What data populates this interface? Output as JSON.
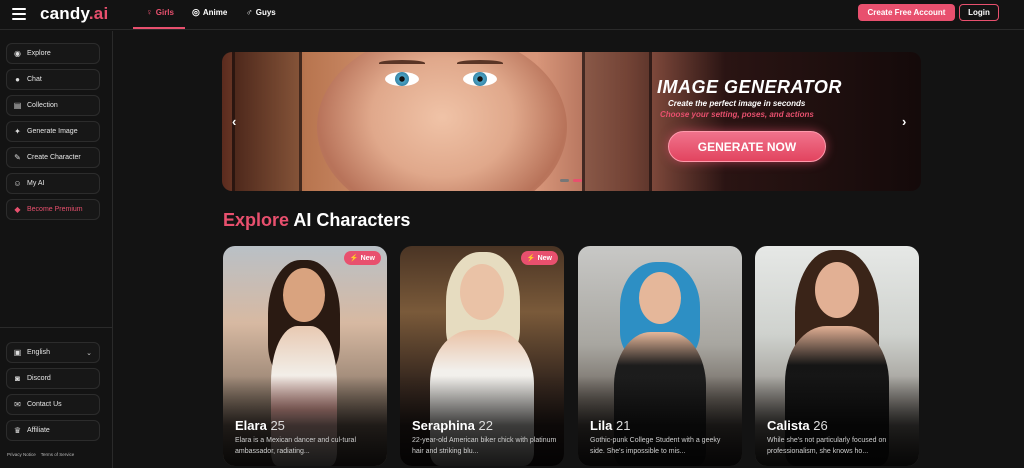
{
  "header": {
    "logo_text": "candy",
    "logo_dot": ".ai",
    "tabs": [
      {
        "label": "Girls",
        "icon": "female-icon",
        "glyph": "♀"
      },
      {
        "label": "Anime",
        "icon": "anime-icon",
        "glyph": "◎"
      },
      {
        "label": "Guys",
        "icon": "male-icon",
        "glyph": "♂"
      }
    ],
    "create_account": "Create Free Account",
    "login": "Login"
  },
  "sidebar": {
    "items": [
      {
        "label": "Explore",
        "icon": "compass-icon",
        "glyph": "◉"
      },
      {
        "label": "Chat",
        "icon": "chat-icon",
        "glyph": "●"
      },
      {
        "label": "Collection",
        "icon": "collection-icon",
        "glyph": "▤"
      },
      {
        "label": "Generate Image",
        "icon": "image-gen-icon",
        "glyph": "✦"
      },
      {
        "label": "Create Character",
        "icon": "wand-icon",
        "glyph": "✎"
      },
      {
        "label": "My AI",
        "icon": "mask-icon",
        "glyph": "☺"
      },
      {
        "label": "Become Premium",
        "icon": "diamond-icon",
        "glyph": "◆"
      }
    ],
    "bottom": [
      {
        "label": "English",
        "icon": "flag-icon",
        "glyph": "▣"
      },
      {
        "label": "Discord",
        "icon": "discord-icon",
        "glyph": "◙"
      },
      {
        "label": "Contact Us",
        "icon": "mail-icon",
        "glyph": "✉"
      },
      {
        "label": "Affiliate",
        "icon": "trophy-icon",
        "glyph": "♛"
      }
    ],
    "footer_links": [
      "Privacy Notice",
      "Terms of Service"
    ]
  },
  "banner": {
    "title": "IMAGE GENERATOR",
    "subtitle": "Create the perfect image in seconds",
    "subtitle2": "Choose your setting, poses, and actions",
    "cta": "GENERATE NOW",
    "prev": "‹",
    "next": "›"
  },
  "section": {
    "title_highlight": "Explore",
    "title_rest": " AI Characters"
  },
  "cards": [
    {
      "name": "Elara",
      "age": "25",
      "badge": "New",
      "desc": "Elara is a Mexican dancer and cul-tural ambassador, radiating..."
    },
    {
      "name": "Seraphina",
      "age": "22",
      "badge": "New",
      "desc": "22-year-old American biker chick with platinum hair and striking blu..."
    },
    {
      "name": "Lila",
      "age": "21",
      "badge": "",
      "desc": "Gothic-punk College Student with a geeky side. She's impossible to mis..."
    },
    {
      "name": "Calista",
      "age": "26",
      "badge": "",
      "desc": "While she's not particularly focused on professionalism, she knows ho..."
    }
  ],
  "colors": {
    "accent": "#e8506e",
    "background": "#131313"
  }
}
